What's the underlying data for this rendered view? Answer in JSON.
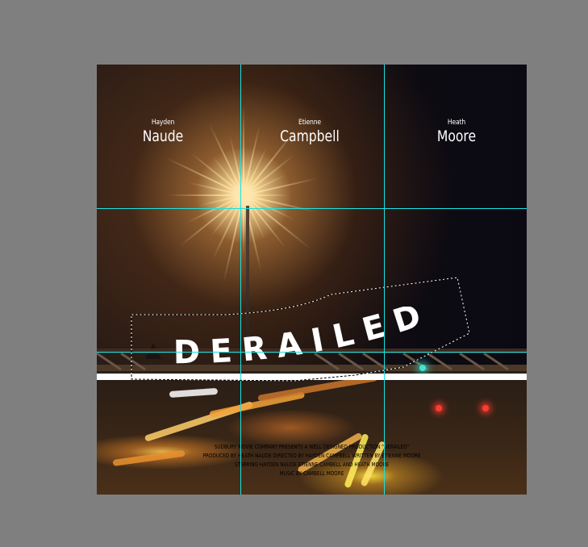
{
  "poster": {
    "credits": [
      {
        "first": "Hayden",
        "last": "Naude"
      },
      {
        "first": "Etienne",
        "last": "Campbell"
      },
      {
        "first": "Heath",
        "last": "Moore"
      }
    ],
    "title": "DERAILED",
    "billing": [
      "SUDBURY MOVIE COMPANY PRESENTS A WELL DESIGNED PRODUCTION \"DERAILED\"",
      "PRODUCED BY HEATH NAUDE DIRECTED BY HAYDEN CAMPBELL WRITTEN BY ETIENNE MOORE",
      "STARRING HAYDEN NAUDE ETIENNE CAMBELL AND HEATH MOORE",
      "MUSIC BY CAMBELL MOORE"
    ]
  },
  "colors": {
    "workspace": "#7f7f7f",
    "guide": "#19e3e3",
    "title": "#ffffff",
    "bar": "#ffffff",
    "signal_teal": "#3fe6d0",
    "signal_red": "#ff3b2f"
  },
  "icons": [
    "lamp-flare-icon",
    "signal-light-icon"
  ]
}
